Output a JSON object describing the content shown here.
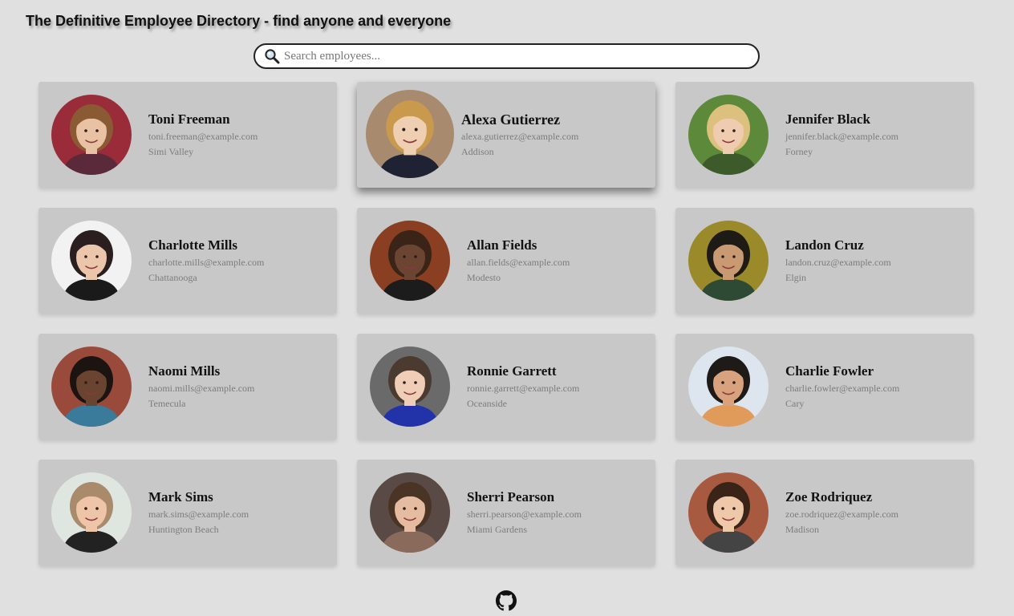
{
  "header": {
    "title": "The Definitive Employee Directory - find anyone and everyone"
  },
  "search": {
    "placeholder": "Search employees...",
    "value": "",
    "icon": "search-icon"
  },
  "employees": [
    {
      "name": "Toni Freeman",
      "email": "toni.freeman@example.com",
      "city": "Simi Valley",
      "skin": "#e9c2a3",
      "hair": "#8a5a34",
      "bg": "#9a2c3a",
      "shirt": "#5a2a3a"
    },
    {
      "name": "Alexa Gutierrez",
      "email": "alexa.gutierrez@example.com",
      "city": "Addison",
      "skin": "#efcfb1",
      "hair": "#c99a4e",
      "bg": "#a88a6e",
      "shirt": "#1e2233"
    },
    {
      "name": "Jennifer Black",
      "email": "jennifer.black@example.com",
      "city": "Forney",
      "skin": "#efcbaf",
      "hair": "#dcc07e",
      "bg": "#5d8a3a",
      "shirt": "#3c5a2a"
    },
    {
      "name": "Charlotte Mills",
      "email": "charlotte.mills@example.com",
      "city": "Chattanooga",
      "skin": "#ecc6aa",
      "hair": "#2a1e1e",
      "bg": "#f2f2f2",
      "shirt": "#1a1a1a"
    },
    {
      "name": "Allan Fields",
      "email": "allan.fields@example.com",
      "city": "Modesto",
      "skin": "#6b4432",
      "hair": "#3a2418",
      "bg": "#8a3f22",
      "shirt": "#1c1c1c"
    },
    {
      "name": "Landon Cruz",
      "email": "landon.cruz@example.com",
      "city": "Elgin",
      "skin": "#c99a72",
      "hair": "#1e1a16",
      "bg": "#9a8a2a",
      "shirt": "#2f4a34"
    },
    {
      "name": "Naomi Mills",
      "email": "naomi.mills@example.com",
      "city": "Temecula",
      "skin": "#6a4331",
      "hair": "#1c1410",
      "bg": "#9a4a3a",
      "shirt": "#3a7a9a"
    },
    {
      "name": "Ronnie Garrett",
      "email": "ronnie.garrett@example.com",
      "city": "Oceanside",
      "skin": "#f0cdb6",
      "hair": "#4a3a30",
      "bg": "#6a6a6a",
      "shirt": "#2233aa"
    },
    {
      "name": "Charlie Fowler",
      "email": "charlie.fowler@example.com",
      "city": "Cary",
      "skin": "#d8a27e",
      "hair": "#1e1a18",
      "bg": "#dde6ee",
      "shirt": "#e09a5a"
    },
    {
      "name": "Mark Sims",
      "email": "mark.sims@example.com",
      "city": "Huntington Beach",
      "skin": "#eec5a6",
      "hair": "#a98a6a",
      "bg": "#dfe6e0",
      "shirt": "#222222"
    },
    {
      "name": "Sherri Pearson",
      "email": "sherri.pearson@example.com",
      "city": "Miami Gardens",
      "skin": "#e6bca0",
      "hair": "#4a3426",
      "bg": "#5a4a46",
      "shirt": "#8a6a5a"
    },
    {
      "name": "Zoe Rodriquez",
      "email": "zoe.rodriquez@example.com",
      "city": "Madison",
      "skin": "#efc8aa",
      "hair": "#3a2418",
      "bg": "#a85a40",
      "shirt": "#444444"
    }
  ],
  "hovered_index": 1,
  "footer": {
    "icon": "github-icon"
  }
}
